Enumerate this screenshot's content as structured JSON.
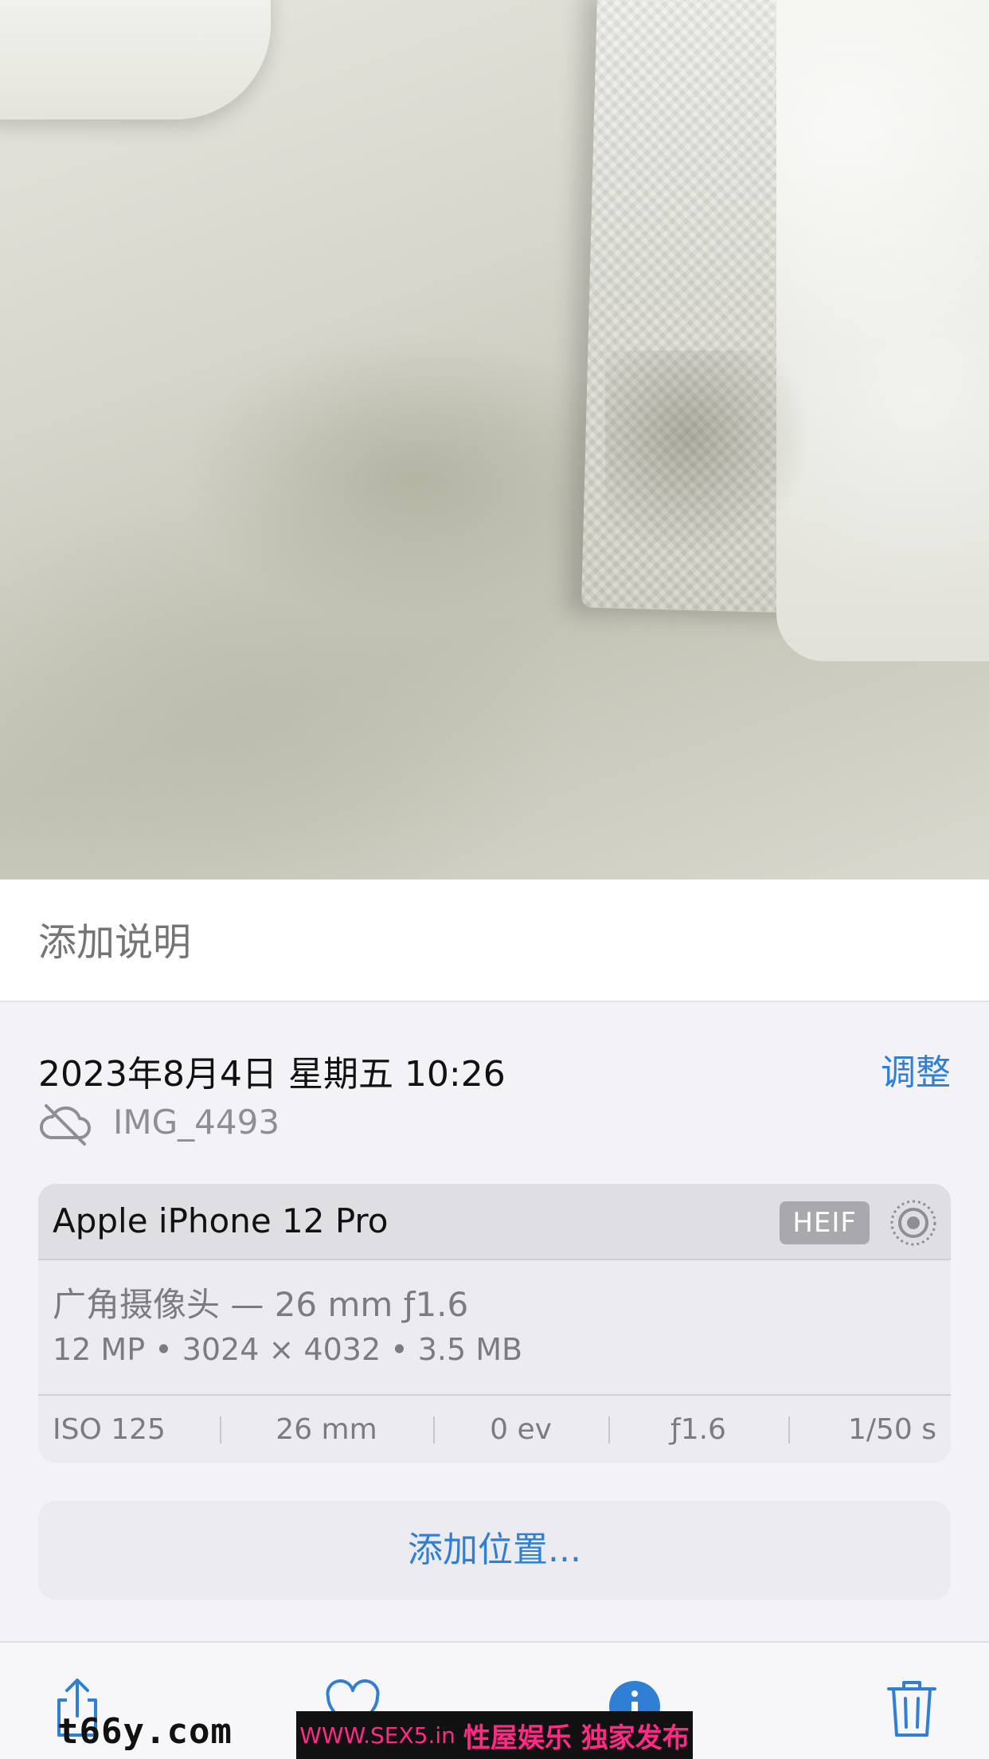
{
  "caption": {
    "placeholder": "添加说明"
  },
  "info": {
    "datetime": "2023年8月4日 星期五 10:26",
    "adjust_label": "调整",
    "filename": "IMG_4493",
    "icon": "cloud-off-icon"
  },
  "camera": {
    "device": "Apple iPhone 12 Pro",
    "format_badge": "HEIF",
    "lens": "广角摄像头 — 26 mm ƒ1.6",
    "specs": "12 MP • 3024 × 4032 • 3.5 MB",
    "exif": [
      "ISO 125",
      "26 mm",
      "0 ev",
      "ƒ1.6",
      "1/50 s"
    ]
  },
  "location": {
    "label": "添加位置..."
  },
  "toolbar": {
    "icons": [
      "share-icon",
      "heart-icon",
      "info-icon",
      "trash-icon"
    ],
    "accent": "#2f7fd4"
  },
  "watermark": {
    "left": "t66y.com",
    "url": "WWW.SEX5.in",
    "text": "性屋娱乐 独家发布"
  }
}
